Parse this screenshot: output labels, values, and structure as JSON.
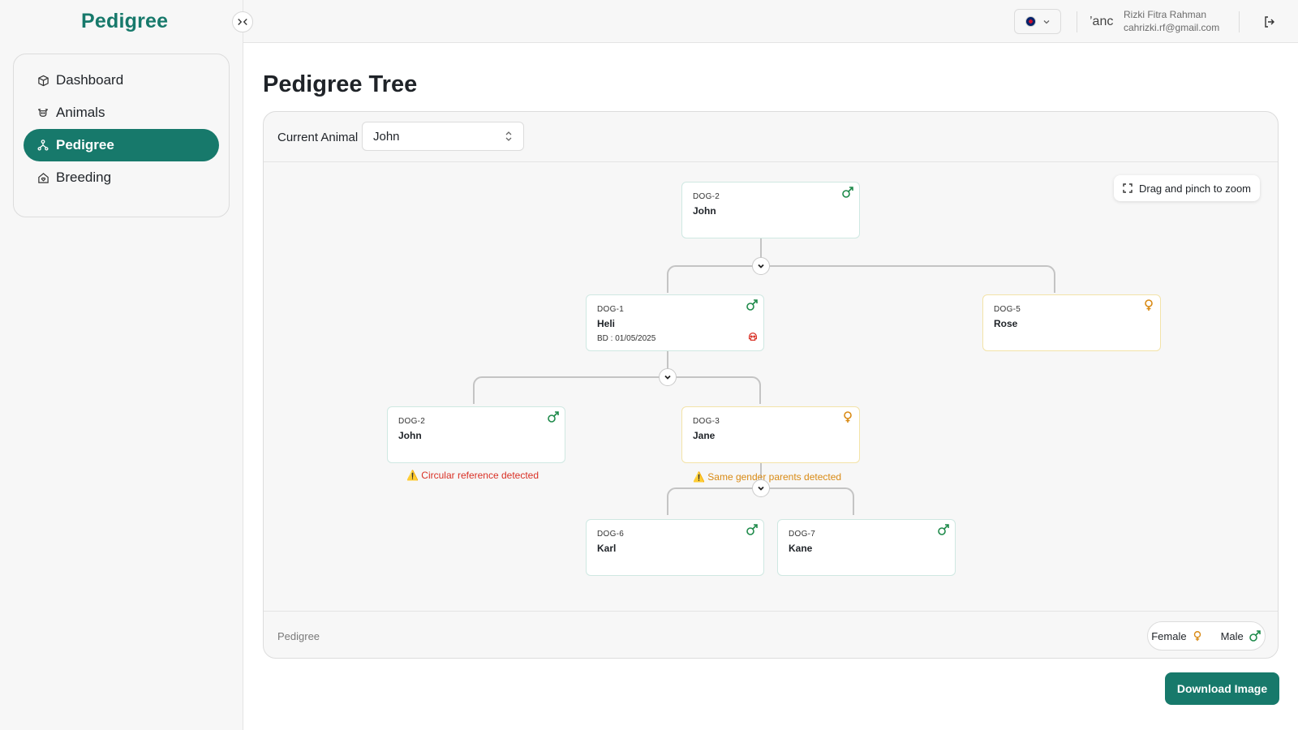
{
  "app": {
    "brand": "Pedigree"
  },
  "sidebar": {
    "items": [
      {
        "label": "Dashboard",
        "icon": "box-icon",
        "active": false
      },
      {
        "label": "Animals",
        "icon": "cow-icon",
        "active": false
      },
      {
        "label": "Pedigree",
        "icon": "tree-icon",
        "active": true
      },
      {
        "label": "Breeding",
        "icon": "home-heart-icon",
        "active": false
      }
    ]
  },
  "header": {
    "language": "en-gb-flag",
    "user": {
      "avatar_alt": "’anc",
      "name": "Rizki Fitra Rahman",
      "email": "cahrizki.rf@gmail.com"
    }
  },
  "page": {
    "title": "Pedigree Tree",
    "current_animal_label": "Current Animal",
    "current_animal_value": "John",
    "zoom_hint": "Drag and pinch to zoom",
    "footer_label": "Pedigree",
    "legend": {
      "female": "Female",
      "male": "Male"
    },
    "download_label": "Download Image"
  },
  "tree": {
    "nodes": [
      {
        "id": "n0",
        "code": "DOG-2",
        "name": "John",
        "gender": "male"
      },
      {
        "id": "n1",
        "code": "DOG-1",
        "name": "Heli",
        "gender": "male",
        "bd": "BD : 01/05/2025",
        "deceased": true
      },
      {
        "id": "n2",
        "code": "DOG-5",
        "name": "Rose",
        "gender": "female"
      },
      {
        "id": "n3",
        "code": "DOG-2",
        "name": "John",
        "gender": "male",
        "warning": "⚠️ Circular reference detected"
      },
      {
        "id": "n4",
        "code": "DOG-3",
        "name": "Jane",
        "gender": "female",
        "warning": "⚠️ Same gender parents detected"
      },
      {
        "id": "n5",
        "code": "DOG-6",
        "name": "Karl",
        "gender": "male"
      },
      {
        "id": "n6",
        "code": "DOG-7",
        "name": "Kane",
        "gender": "male"
      }
    ]
  },
  "colors": {
    "brand": "#17796b",
    "male": "#1e8a4a",
    "female": "#d98a14",
    "error": "#d93025"
  }
}
